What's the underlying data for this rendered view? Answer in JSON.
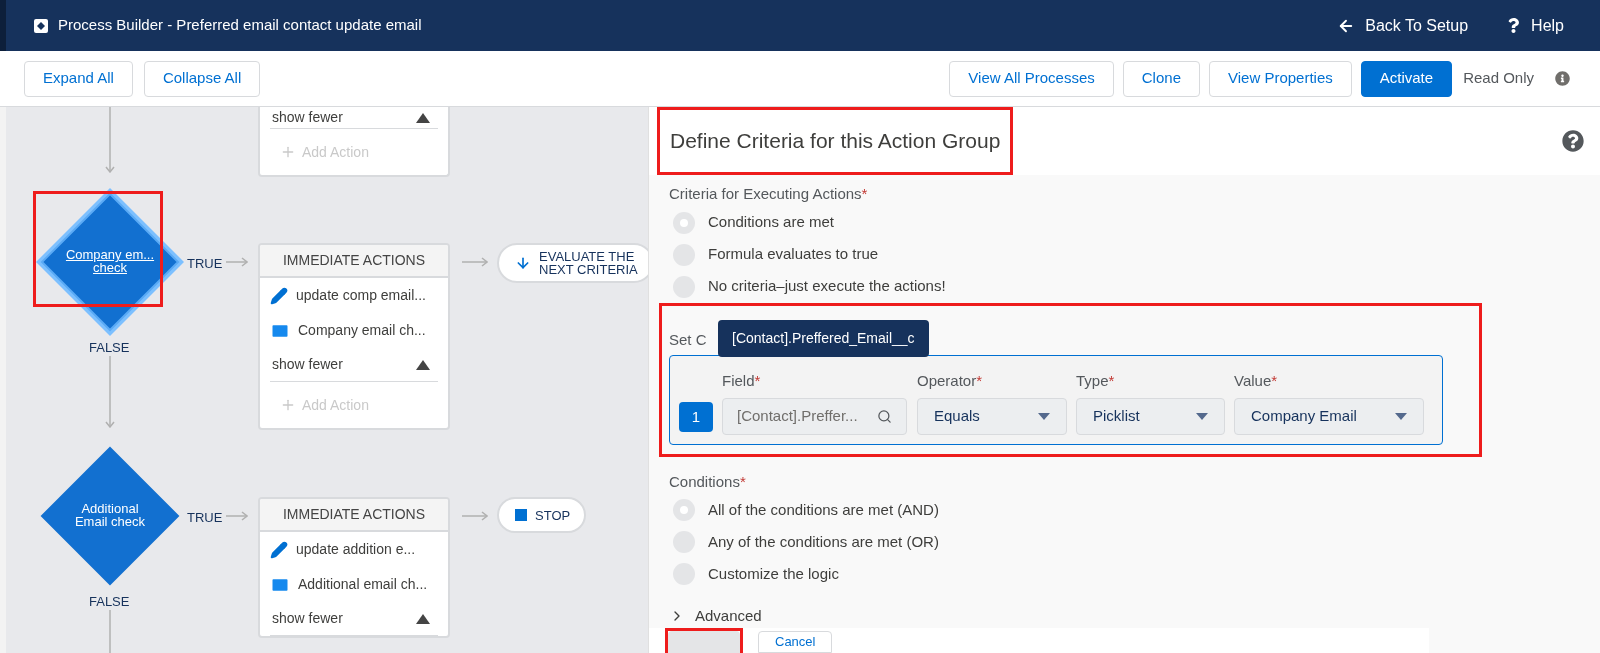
{
  "header": {
    "title": "Process Builder - Preferred email contact update email",
    "links": [
      {
        "kind": "back",
        "label": "Back To Setup"
      },
      {
        "kind": "help",
        "label": "Help"
      }
    ]
  },
  "toolbar": {
    "left_buttons": [
      {
        "label": "Expand All",
        "primary": false
      },
      {
        "label": "Collapse All",
        "primary": false
      }
    ],
    "right_buttons": [
      {
        "label": "View All Processes",
        "primary": false
      },
      {
        "label": "Clone",
        "primary": false
      },
      {
        "label": "View Properties",
        "primary": false
      },
      {
        "label": "Activate",
        "primary": true
      }
    ],
    "status": "Read Only"
  },
  "canvas": {
    "top_card": {
      "toggle": "show fewer",
      "add": "Add Action"
    },
    "criteria": [
      {
        "lines": [
          "Company em...",
          "check"
        ],
        "selected": true,
        "highlighted": true,
        "true_label": "TRUE",
        "false_label": "FALSE",
        "actions": {
          "header": "IMMEDIATE ACTIONS",
          "items": [
            {
              "kind": "update",
              "label": "update comp email..."
            },
            {
              "kind": "email",
              "label": "Company email ch..."
            }
          ],
          "toggle": "show fewer",
          "add": "Add Action"
        },
        "next": {
          "kind": "evaluate",
          "lines": [
            "EVALUATE THE",
            "NEXT CRITERIA"
          ]
        }
      },
      {
        "lines": [
          "Additional",
          "Email check"
        ],
        "selected": false,
        "true_label": "TRUE",
        "false_label": "FALSE",
        "actions": {
          "header": "IMMEDIATE ACTIONS",
          "items": [
            {
              "kind": "update",
              "label": "update addition e..."
            },
            {
              "kind": "email",
              "label": "Additional email ch..."
            }
          ],
          "toggle": "show fewer"
        },
        "next": {
          "kind": "stop",
          "lines": [
            "STOP"
          ]
        }
      }
    ]
  },
  "panel": {
    "title": "Define Criteria for this Action Group",
    "highlighted": true,
    "criteria_label": {
      "text": "Criteria for Executing Actions",
      "mark": "*"
    },
    "criteria_options": [
      {
        "label": "Conditions are met",
        "selected": true
      },
      {
        "label": "Formula evaluates to true",
        "selected": false
      },
      {
        "label": "No criteria–just execute the actions!",
        "selected": false
      }
    ],
    "set_conditions": {
      "label": "Set C",
      "highlighted": true,
      "tooltip": "[Contact].Preffered_Email__c",
      "rows": [
        {
          "number": "1",
          "field_label": {
            "text": "Field",
            "mark": "*"
          },
          "field": "[Contact].Preffer...",
          "operator_label": {
            "text": "Operator",
            "mark": "*"
          },
          "operator": "Equals",
          "type_label": {
            "text": "Type",
            "mark": "*"
          },
          "type": "Picklist",
          "value_label": {
            "text": "Value",
            "mark": "*"
          },
          "value": "Company Email"
        }
      ]
    },
    "conditions_label": {
      "text": "Conditions",
      "mark": "*"
    },
    "conditions_options": [
      {
        "label": "All of the conditions are met (AND)",
        "selected": true
      },
      {
        "label": "Any of the conditions are met (OR)",
        "selected": false
      },
      {
        "label": "Customize the logic",
        "selected": false
      }
    ],
    "advanced": {
      "label": "Advanced",
      "expanded": false
    },
    "footer_buttons": [
      {
        "kind": "save",
        "highlighted": true
      },
      {
        "kind": "cancel",
        "label": "Cancel"
      }
    ]
  }
}
